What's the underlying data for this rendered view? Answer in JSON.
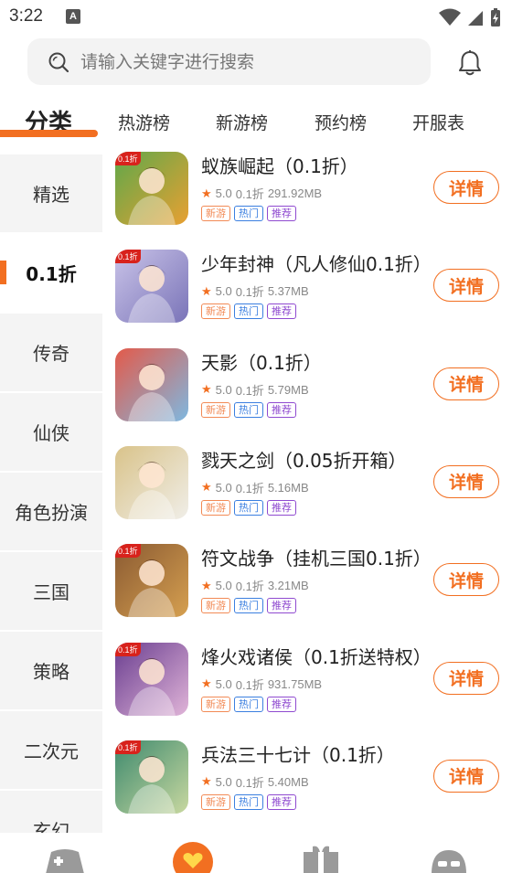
{
  "status": {
    "time": "3:22",
    "notif_letter": "A"
  },
  "search": {
    "placeholder": "请输入关键字进行搜索"
  },
  "tabs": [
    {
      "label": "分类"
    },
    {
      "label": "热游榜"
    },
    {
      "label": "新游榜"
    },
    {
      "label": "预约榜"
    },
    {
      "label": "开服表"
    }
  ],
  "sidebar": {
    "items": [
      {
        "label": "精选"
      },
      {
        "label": "0.1折"
      },
      {
        "label": "传奇"
      },
      {
        "label": "仙侠"
      },
      {
        "label": "角色扮演"
      },
      {
        "label": "三国"
      },
      {
        "label": "策略"
      },
      {
        "label": "二次元"
      },
      {
        "label": "玄幻"
      }
    ]
  },
  "games": [
    {
      "name": "蚁族崛起（0.1折）",
      "rating": "5.0",
      "discount": "0.1折",
      "size": "291.92MB",
      "tags": [
        "新游",
        "热门",
        "推荐"
      ],
      "button": "详情",
      "badge": "0.1折",
      "colors": [
        "#5fa84a",
        "#e8a032"
      ]
    },
    {
      "name": "少年封神（凡人修仙0.1折）",
      "rating": "5.0",
      "discount": "0.1折",
      "size": "5.37MB",
      "tags": [
        "新游",
        "热门",
        "推荐"
      ],
      "button": "详情",
      "badge": "0.1折",
      "colors": [
        "#c9c3e8",
        "#7a74b8"
      ]
    },
    {
      "name": "天影（0.1折）",
      "rating": "5.0",
      "discount": "0.1折",
      "size": "5.79MB",
      "tags": [
        "新游",
        "热门",
        "推荐"
      ],
      "button": "详情",
      "badge": "",
      "colors": [
        "#e35a4a",
        "#7fb8e0"
      ]
    },
    {
      "name": "戮天之剑（0.05折开箱）",
      "rating": "5.0",
      "discount": "0.1折",
      "size": "5.16MB",
      "tags": [
        "新游",
        "热门",
        "推荐"
      ],
      "button": "详情",
      "badge": "",
      "colors": [
        "#d9c38a",
        "#f0eee8"
      ]
    },
    {
      "name": "符文战争（挂机三国0.1折）",
      "rating": "5.0",
      "discount": "0.1折",
      "size": "3.21MB",
      "tags": [
        "新游",
        "热门",
        "推荐"
      ],
      "button": "详情",
      "badge": "0.1折",
      "colors": [
        "#8a5a32",
        "#d6a050"
      ]
    },
    {
      "name": "烽火戏诸侯（0.1折送特权）",
      "rating": "5.0",
      "discount": "0.1折",
      "size": "931.75MB",
      "tags": [
        "新游",
        "热门",
        "推荐"
      ],
      "button": "详情",
      "badge": "0.1折",
      "colors": [
        "#6a3e90",
        "#e0b4d8"
      ]
    },
    {
      "name": "兵法三十七计（0.1折）",
      "rating": "5.0",
      "discount": "0.1折",
      "size": "5.40MB",
      "tags": [
        "新游",
        "热门",
        "推荐"
      ],
      "button": "详情",
      "badge": "0.1折",
      "colors": [
        "#3e8a6e",
        "#c8d8a0"
      ]
    }
  ],
  "theme": {
    "accent": "#f26f21",
    "sidebar_bg": "#f4f4f4"
  }
}
